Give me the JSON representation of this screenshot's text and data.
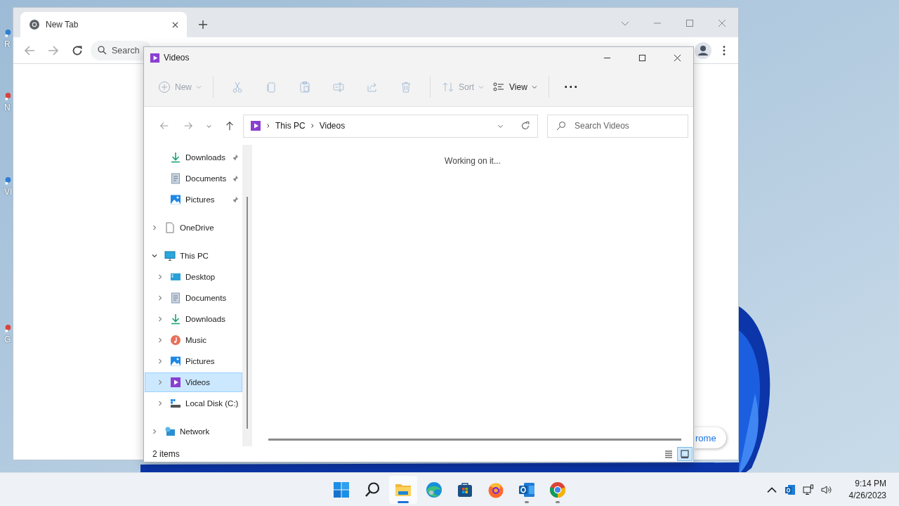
{
  "desktop": {
    "icons": [
      {
        "label": "R"
      },
      {
        "label": "N"
      },
      {
        "label": "VI"
      },
      {
        "label": "G"
      }
    ]
  },
  "chrome": {
    "tab": {
      "title": "New Tab",
      "selected": true
    },
    "omnibox": {
      "placeholder": "Search"
    },
    "page_button": "rome"
  },
  "explorer": {
    "title": "Videos",
    "toolbar": [
      {
        "kind": "new",
        "label": "New",
        "disabled": true
      },
      {
        "kind": "cut",
        "disabled": true
      },
      {
        "kind": "copy",
        "disabled": true
      },
      {
        "kind": "paste",
        "disabled": true
      },
      {
        "kind": "rename",
        "disabled": true
      },
      {
        "kind": "share",
        "disabled": true
      },
      {
        "kind": "delete",
        "disabled": true
      },
      {
        "kind": "sort",
        "label": "Sort",
        "disabled": true
      },
      {
        "kind": "view",
        "label": "View",
        "disabled": false
      },
      {
        "kind": "more",
        "label": "···",
        "disabled": false
      }
    ],
    "address": {
      "segments": [
        "This PC",
        "Videos"
      ]
    },
    "search": {
      "placeholder": "Search Videos"
    },
    "nav": [
      {
        "kind": "download",
        "label": "Downloads",
        "pinned": true,
        "selected": false
      },
      {
        "kind": "document",
        "label": "Documents",
        "pinned": true,
        "selected": false
      },
      {
        "kind": "picture",
        "label": "Pictures",
        "pinned": true,
        "selected": false
      },
      {
        "kind": "file",
        "label": "OneDrive",
        "pinned": false,
        "selected": false,
        "expanded": false
      },
      {
        "kind": "pc",
        "label": "This PC",
        "pinned": false,
        "selected": false,
        "expanded": true,
        "children": [
          {
            "kind": "desktop",
            "label": "Desktop",
            "pinned": false,
            "selected": false,
            "expanded": false
          },
          {
            "kind": "document",
            "label": "Documents",
            "pinned": false,
            "selected": false,
            "expanded": false
          },
          {
            "kind": "download",
            "label": "Downloads",
            "pinned": false,
            "selected": false,
            "expanded": false
          },
          {
            "kind": "music",
            "label": "Music",
            "pinned": false,
            "selected": false,
            "expanded": false
          },
          {
            "kind": "picture",
            "label": "Pictures",
            "pinned": false,
            "selected": false,
            "expanded": false
          },
          {
            "kind": "video",
            "label": "Videos",
            "pinned": false,
            "selected": true,
            "expanded": false
          },
          {
            "kind": "disk",
            "label": "Local Disk (C:)",
            "pinned": false,
            "selected": false,
            "expanded": false
          }
        ]
      },
      {
        "kind": "network",
        "label": "Network",
        "pinned": false,
        "selected": false,
        "expanded": false
      }
    ],
    "message": "Working on it...",
    "status": "2 items",
    "views": [
      {
        "kind": "details",
        "selected": false
      },
      {
        "kind": "tiles",
        "selected": true
      }
    ]
  },
  "taskbar": {
    "apps": [
      {
        "kind": "start",
        "running": false,
        "active": false
      },
      {
        "kind": "search",
        "running": false,
        "active": false
      },
      {
        "kind": "explorer",
        "running": true,
        "active": true
      },
      {
        "kind": "edge",
        "running": false,
        "active": false
      },
      {
        "kind": "store",
        "running": false,
        "active": false
      },
      {
        "kind": "firefox",
        "running": false,
        "active": false
      },
      {
        "kind": "outlook",
        "running": true,
        "active": false
      },
      {
        "kind": "chrome",
        "running": true,
        "active": false
      }
    ],
    "time": "9:14 PM",
    "date": "4/26/2023"
  }
}
